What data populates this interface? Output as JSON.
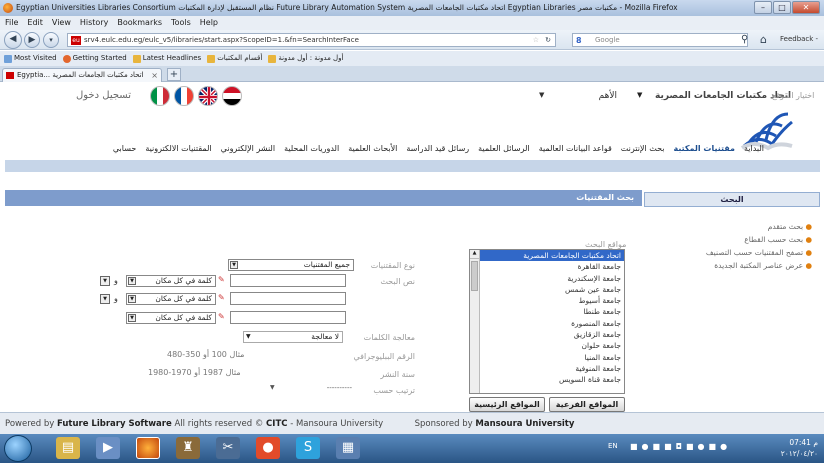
{
  "window": {
    "title": "Egyptian Universities Libraries Consortium نظام المستقبل لإدارة المكتبات Future Library Automation System اتحاد مكتبات الجامعات المصرية Egyptian Libraries مكتبات مصر - Mozilla Firefox",
    "min": "–",
    "max": "□",
    "close": "✕"
  },
  "menu": [
    "File",
    "Edit",
    "View",
    "History",
    "Bookmarks",
    "Tools",
    "Help"
  ],
  "nav": {
    "url": "srv4.eulc.edu.eg/eulc_v5/libraries/start.aspx?ScopeID=1.&fn=SearchInterFace",
    "search_placeholder": "Google",
    "feedback": "Feedback -"
  },
  "bookmarks": [
    "Most Visited",
    "Getting Started",
    "Latest Headlines",
    "أقسام المكتبات",
    "أول مدونة : أول مدونة"
  ],
  "tab": {
    "label": "Egyptia... اتحاد مكتبات الجامعات المصرية",
    "close": "×",
    "new": "+"
  },
  "header": {
    "login": "تسجيل دخول",
    "lang_select": "الأهم",
    "site_select_label": "اختيار الموقع",
    "site_select_value": "اتحاد مكتبات الجامعات المصرية"
  },
  "mainnav": [
    "البداية",
    "مقتنيات المكتبة",
    "بحث الإنترنت",
    "قواعد البيانات العالمية",
    "الرسائل العلمية",
    "رسائل قيد الدراسة",
    "الأبحاث العلمية",
    "الدوريات المحلية",
    "النشر الإلكتروني",
    "المقتنيات الالكترونية",
    "حسابي"
  ],
  "search_panel": {
    "title": "بحث المقتنيات",
    "labels": {
      "material_type": "نوع المقتنيات",
      "search_text": "نص البحث",
      "word_processing": "معالجة الكلمات",
      "bib_number": "الرقم الببليوجرافي",
      "pub_year": "سنة النشر",
      "sort_by": "ترتيب حسب"
    },
    "material_type_value": "جميع المقتنيات",
    "keyword_value": "كلمة في كل مكان",
    "and": "و",
    "processing_value": "لا معالجة",
    "sort_value": "----------",
    "bib_example": "مثال 100 أو 350-480",
    "year_example": "مثال 1987 أو 1970-1980",
    "sites_label": "مواقع البحث",
    "sites": [
      "اتحاد مكتبات الجامعات المصرية",
      "جامعة القاهرة",
      "جامعة الإسكندرية",
      "جامعة عين شمس",
      "جامعة أسيوط",
      "جامعة طنطا",
      "جامعة المنصورة",
      "جامعة الزقازيق",
      "جامعة حلوان",
      "جامعة المنيا",
      "جامعة المنوفية",
      "جامعة قناة السويس"
    ],
    "btn_branch": "المواقع الفرعية",
    "btn_main": "المواقع الرئيسية"
  },
  "side_panel": {
    "title": "البحث",
    "links": [
      "بحث متقدم",
      "بحث حسب القطاع",
      "تصفح المقتنيات حسب التصنيف",
      "عرض عناصر المكتبة الجديدة"
    ]
  },
  "status": {
    "prefix": "Powered by",
    "software": "Future Library Software",
    "middle": "All rights reserved ©",
    "citc": "CITC",
    "after_citc": "- Mansoura University",
    "sponsored": "Sponsored by",
    "sponsor": "Mansoura University"
  },
  "taskbar": {
    "lang": "EN",
    "time": "07:41 م",
    "date": "٢٠١٢/٠٤/٢٠"
  }
}
